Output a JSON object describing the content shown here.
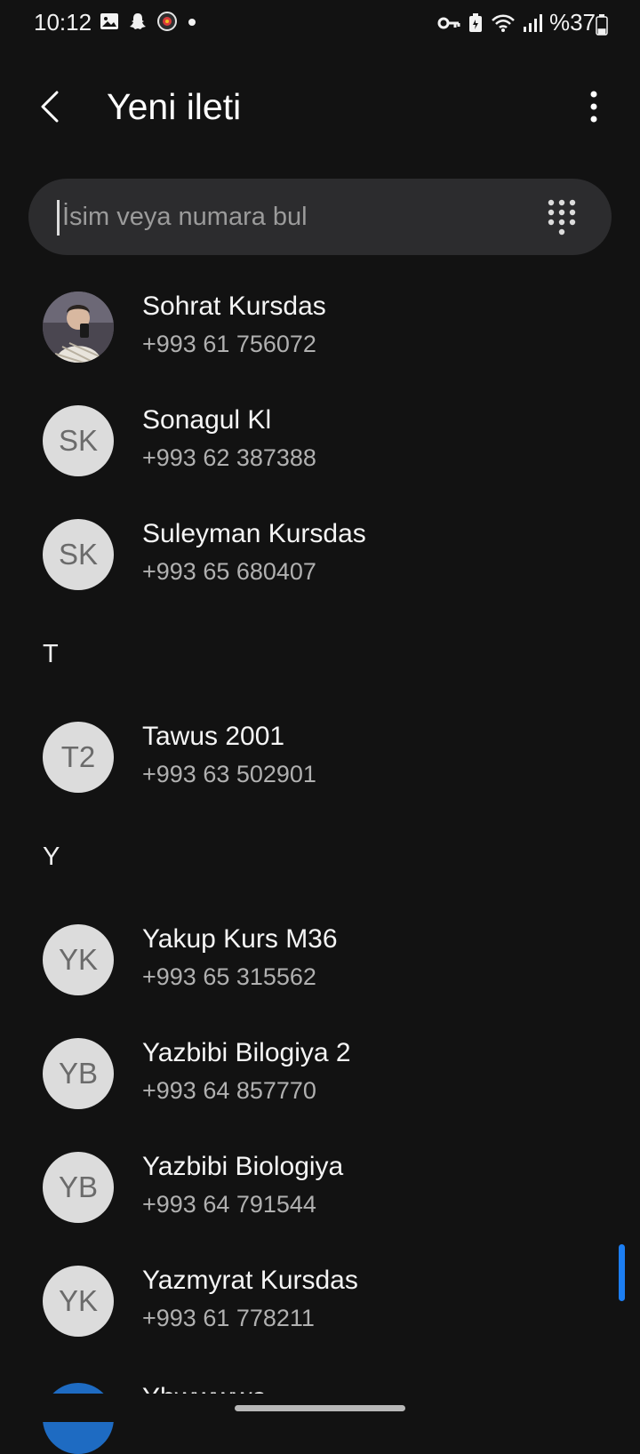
{
  "status_bar": {
    "time": "10:12",
    "battery_text": "%37",
    "left_icons": [
      "gallery-icon",
      "snapchat-icon",
      "app-notification-icon",
      "dot-icon"
    ],
    "right_icons": [
      "vpn-key-icon",
      "battery-saver-icon",
      "wifi-icon",
      "signal-icon",
      "battery-icon"
    ],
    "battery_level": 0.37
  },
  "header": {
    "title": "Yeni ileti",
    "back_icon": "chevron-left-icon",
    "more_icon": "more-vert-icon"
  },
  "search": {
    "placeholder": "İsim veya numara bul",
    "value": "",
    "dialpad_icon": "dialpad-icon"
  },
  "contacts": [
    {
      "name": "Sohrat Kursdas",
      "number": "+993 61 756072",
      "initials": "",
      "has_photo": true
    },
    {
      "name": "Sonagul Kl",
      "number": "+993 62 387388",
      "initials": "SK"
    },
    {
      "name": "Suleyman Kursdas",
      "number": "+993 65 680407",
      "initials": "SK"
    },
    {
      "name": "Tawus 2001",
      "number": "+993 63 502901",
      "initials": "T2"
    },
    {
      "name": "Yakup Kurs M36",
      "number": "+993 65 315562",
      "initials": "YK"
    },
    {
      "name": "Yazbibi Bilogiya 2",
      "number": "+993 64 857770",
      "initials": "YB"
    },
    {
      "name": "Yazbibi Biologiya",
      "number": "+993 64 791544",
      "initials": "YB"
    },
    {
      "name": "Yazmyrat Kursdas",
      "number": "+993 61 778211",
      "initials": "YK"
    }
  ],
  "sections": {
    "t": "T",
    "y": "Y"
  },
  "partial_contact": {
    "name": "Yhwwwwa Kursdas"
  },
  "colors": {
    "background": "#121212",
    "search_bg": "#2c2c2e",
    "avatar_bg": "#dcdcdc",
    "scroll_accent": "#1c7ef2"
  }
}
